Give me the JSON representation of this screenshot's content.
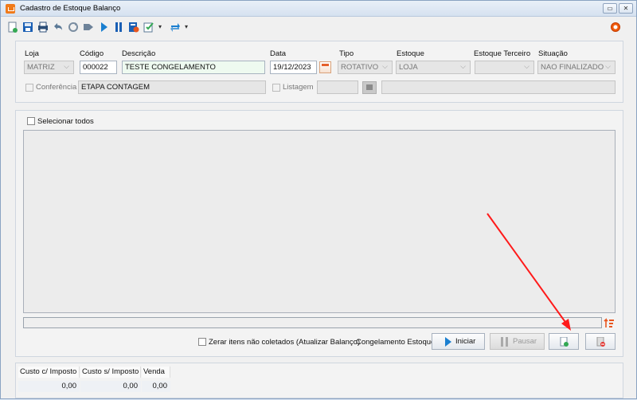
{
  "window": {
    "title": "Cadastro de Estoque Balanço",
    "controls": {
      "minimize": "▭",
      "close": "✕"
    }
  },
  "toolbar": {
    "icons": [
      "new-icon",
      "save-icon",
      "print-icon",
      "undo-icon",
      "refresh-icon",
      "tag-icon",
      "play-icon",
      "pause-icon",
      "freeze-icon",
      "checklist-icon",
      "sync-icon"
    ],
    "dropdown_arrow": "▾"
  },
  "form": {
    "loja": {
      "label": "Loja",
      "value": "MATRIZ"
    },
    "codigo": {
      "label": "Código",
      "value": "000022"
    },
    "descricao": {
      "label": "Descrição",
      "value": "TESTE CONGELAMENTO"
    },
    "data": {
      "label": "Data",
      "value": "19/12/2023"
    },
    "tipo": {
      "label": "Tipo",
      "value": "ROTATIVO"
    },
    "estoque": {
      "label": "Estoque",
      "value": "LOJA"
    },
    "estoque_terceiro": {
      "label": "Estoque Terceiro",
      "value": ""
    },
    "situacao": {
      "label": "Situação",
      "value": "NAO FINALIZADO"
    },
    "conferencia": {
      "label": "Conferência",
      "value": "ETAPA CONTAGEM"
    },
    "listagem": {
      "label": "Listagem",
      "value": "",
      "extra": ""
    }
  },
  "main": {
    "select_all_label": "Selecionar todos",
    "zerar_label": "Zerar itens não coletados (Atualizar Balanço)",
    "congelamento_label": "Congelamento Estoque",
    "iniciar_label": "Iniciar",
    "pausar_label": "Pausar"
  },
  "totals": {
    "headers": [
      "Custo c/ Imposto",
      "Custo s/ Imposto",
      "Venda"
    ],
    "values": [
      "0,00",
      "0,00",
      "0,00"
    ]
  },
  "colors": {
    "accent": "#1a7fd0",
    "annotation": "#ff1a1a",
    "orange": "#f07a1a"
  }
}
